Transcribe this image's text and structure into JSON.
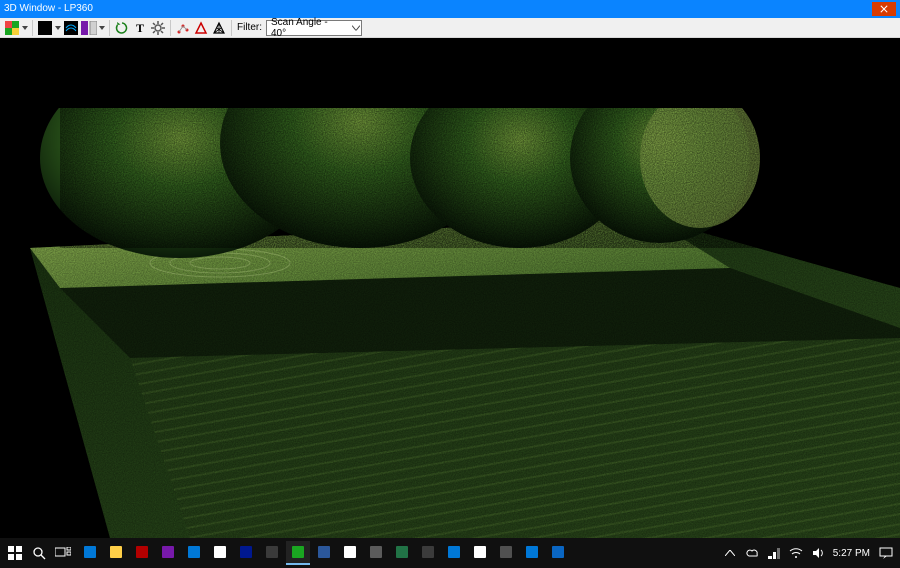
{
  "window": {
    "title": "3D Window - LP360"
  },
  "toolbar": {
    "filter_label": "Filter:",
    "filter_value": "Scan Angle - 40°",
    "icons": {
      "color_view": "color-view",
      "view_mode": "view-mode",
      "contour": "contour",
      "reference": "reference",
      "refresh": "refresh",
      "text_tool": "text",
      "settings": "settings",
      "point_class": "point-class",
      "triangle": "triangle",
      "tin": "tin"
    },
    "colors": {
      "primary_swatch": "#1aa621",
      "view_swatch": "#000000"
    }
  },
  "taskbar": {
    "apps": [
      {
        "name": "mail",
        "color": "#0078d7"
      },
      {
        "name": "file-explorer",
        "color": "#ffcf48"
      },
      {
        "name": "filezilla",
        "color": "#b30000"
      },
      {
        "name": "onenote",
        "color": "#7719aa"
      },
      {
        "name": "settings",
        "color": "#0078d7"
      },
      {
        "name": "app-1",
        "color": "#ffffff"
      },
      {
        "name": "app-2",
        "color": "#00188f"
      },
      {
        "name": "drone",
        "color": "#3a3a3a"
      },
      {
        "name": "lp360",
        "color": "#1aa621"
      },
      {
        "name": "app-3",
        "color": "#2b579a"
      },
      {
        "name": "chrome",
        "color": "#ffffff"
      },
      {
        "name": "app-4",
        "color": "#5b5b5b"
      },
      {
        "name": "excel",
        "color": "#217346"
      },
      {
        "name": "app-5",
        "color": "#3b3b3b"
      },
      {
        "name": "app-6",
        "color": "#0078d7"
      },
      {
        "name": "app-7",
        "color": "#ffffff"
      },
      {
        "name": "app-8",
        "color": "#505050"
      },
      {
        "name": "app-9",
        "color": "#0078d7"
      },
      {
        "name": "linkedin",
        "color": "#0a66c2"
      }
    ],
    "tray": {
      "icons": [
        "cloud",
        "bluetooth",
        "wifi",
        "volume"
      ],
      "time": "5:27 PM"
    }
  }
}
